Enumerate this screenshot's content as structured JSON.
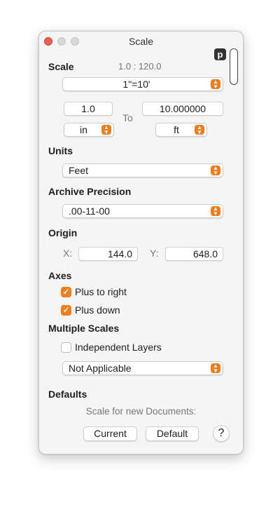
{
  "window": {
    "title": "Scale"
  },
  "p_badge": "p",
  "scale": {
    "heading": "Scale",
    "ratio": "1.0 : 120.0",
    "preset": "1\"=10'",
    "from_value": "1.0",
    "to_label": "To",
    "to_value": "10.000000",
    "from_unit": "in",
    "to_unit": "ft"
  },
  "units": {
    "heading": "Units",
    "value": "Feet"
  },
  "archive_precision": {
    "heading": "Archive Precision",
    "value": ".00-11-00"
  },
  "origin": {
    "heading": "Origin",
    "x_label": "X:",
    "x_value": "144.0",
    "y_label": "Y:",
    "y_value": "648.0"
  },
  "axes": {
    "heading": "Axes",
    "plus_right": {
      "label": "Plus to right",
      "checked": true
    },
    "plus_down": {
      "label": "Plus down",
      "checked": true
    }
  },
  "multiple_scales": {
    "heading": "Multiple Scales",
    "independent_layers": {
      "label": "Independent Layers",
      "checked": false
    },
    "value": "Not Applicable"
  },
  "defaults": {
    "heading": "Defaults",
    "note": "Scale for new Documents:",
    "current_label": "Current",
    "default_label": "Default",
    "help_label": "?"
  },
  "colors": {
    "accent": "#f07d1c",
    "close": "#ec5f57"
  },
  "icons": {
    "popup": "chevron-updown-icon",
    "check": "checkmark-icon",
    "help": "question-icon"
  }
}
